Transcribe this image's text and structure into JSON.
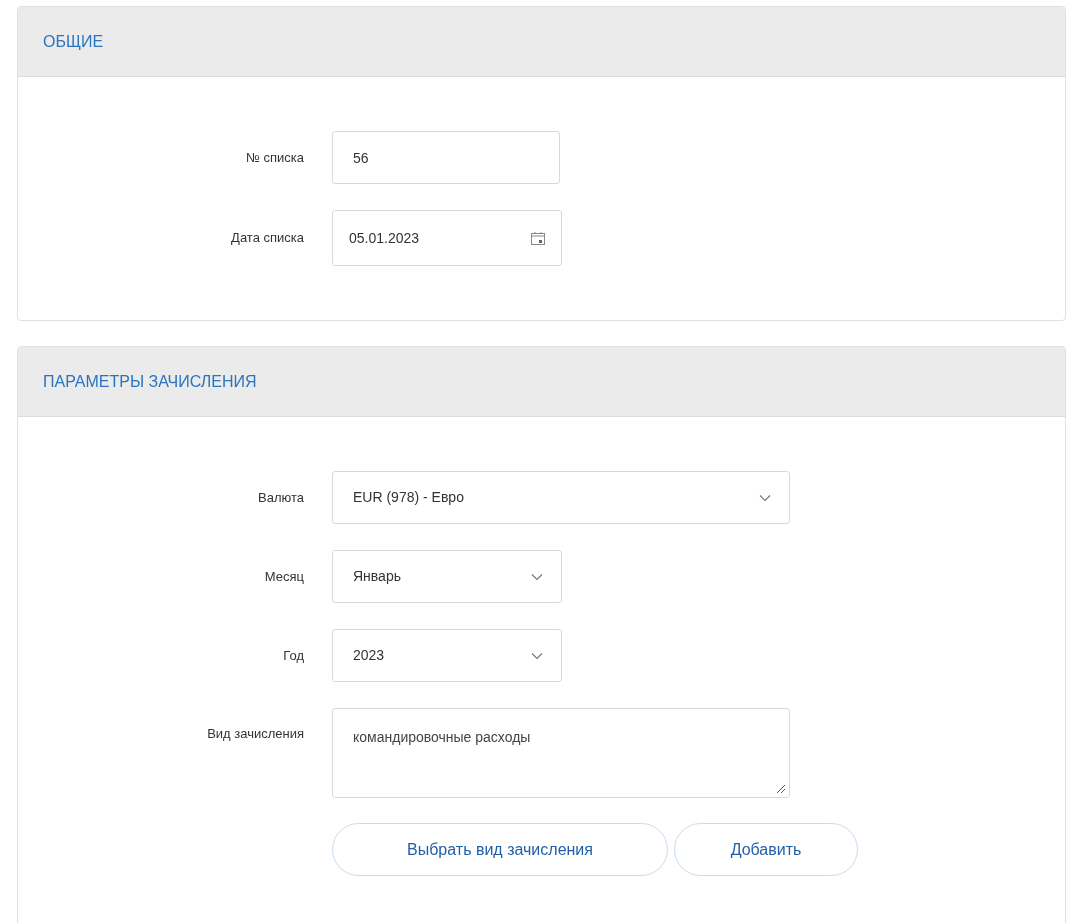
{
  "sections": [
    {
      "title": "ОБЩИЕ",
      "fields": [
        {
          "kind": "text",
          "label": "№ списка",
          "value": "56"
        },
        {
          "kind": "date",
          "label": "Дата списка",
          "value": "05.01.2023"
        }
      ]
    },
    {
      "title": "ПАРАМЕТРЫ ЗАЧИСЛЕНИЯ",
      "fields": [
        {
          "kind": "combobox",
          "label": "Валюта",
          "value": "EUR (978) - Евро"
        },
        {
          "kind": "select",
          "label": "Месяц",
          "value": "Январь"
        },
        {
          "kind": "select",
          "label": "Год",
          "value": "2023"
        },
        {
          "kind": "textarea",
          "label": "Вид зачисления",
          "value": "командировочные расходы"
        }
      ],
      "buttons": [
        "Выбрать вид зачисления",
        "Добавить"
      ]
    }
  ]
}
